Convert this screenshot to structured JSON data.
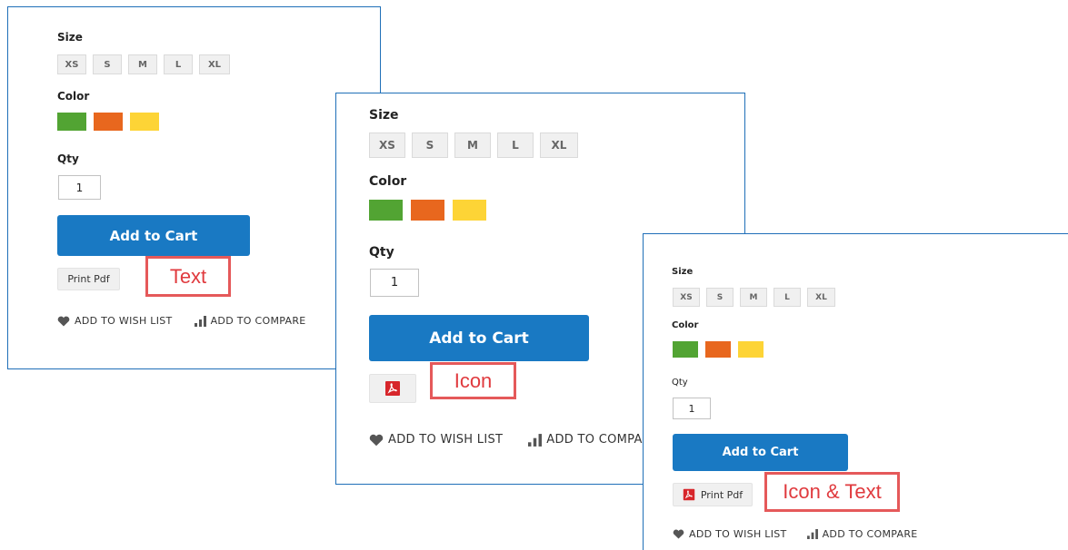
{
  "colors": {
    "panel_border": "#1f6fb8",
    "cart_button": "#1979c3",
    "callout_border": "#e5595a",
    "callout_text": "#e03a3e",
    "swatch_green": "#52a433",
    "swatch_orange": "#e8671e",
    "swatch_yellow": "#fdd436"
  },
  "panel_text": {
    "title": "Text",
    "size_label": "Size",
    "sizes": [
      "XS",
      "S",
      "M",
      "L",
      "XL"
    ],
    "color_label": "Color",
    "swatches": [
      "green",
      "orange",
      "yellow"
    ],
    "qty_label": "Qty",
    "qty_value": "1",
    "add_to_cart": "Add to Cart",
    "pdf_label": "Print Pdf",
    "callout": "Text",
    "wish_list": "ADD TO WISH LIST",
    "compare": "ADD TO COMPARE"
  },
  "panel_icon": {
    "size_label": "Size",
    "sizes": [
      "XS",
      "S",
      "M",
      "L",
      "XL"
    ],
    "color_label": "Color",
    "swatches": [
      "green",
      "orange",
      "yellow"
    ],
    "qty_label": "Qty",
    "qty_value": "1",
    "add_to_cart": "Add to Cart",
    "pdf_icon": "pdf-icon",
    "callout": "Icon",
    "wish_list": "ADD TO WISH LIST",
    "compare": "ADD TO COMPARE"
  },
  "panel_icon_text": {
    "size_label": "Size",
    "sizes": [
      "XS",
      "S",
      "M",
      "L",
      "XL"
    ],
    "color_label": "Color",
    "swatches": [
      "green",
      "orange",
      "yellow"
    ],
    "qty_label": "Qty",
    "qty_value": "1",
    "add_to_cart": "Add to Cart",
    "pdf_label": "Print Pdf",
    "pdf_icon": "pdf-icon",
    "callout": "Icon & Text",
    "wish_list": "ADD TO WISH LIST",
    "compare": "ADD TO COMPARE"
  }
}
